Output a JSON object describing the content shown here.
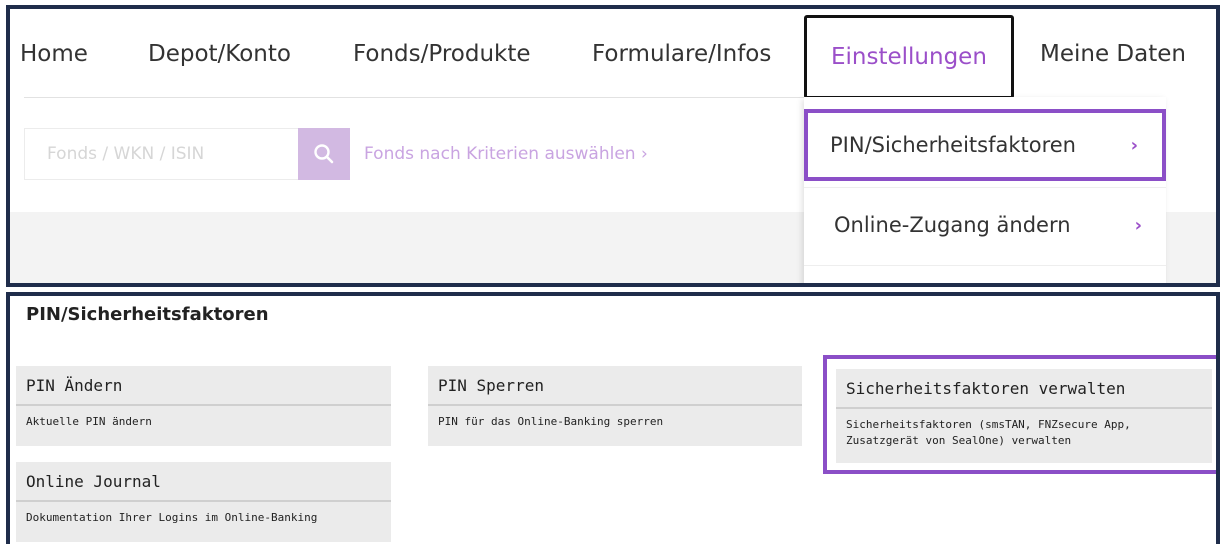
{
  "nav": {
    "items": [
      {
        "label": "Home"
      },
      {
        "label": "Depot/Konto"
      },
      {
        "label": "Fonds/Produkte"
      },
      {
        "label": "Formulare/Infos"
      },
      {
        "label": "Einstellungen",
        "active": true
      },
      {
        "label": "Meine Daten"
      }
    ]
  },
  "search": {
    "placeholder": "Fonds / WKN / ISIN",
    "button_icon": "search-icon",
    "criteria_link": "Fonds nach Kriterien auswählen ›"
  },
  "dropdown": {
    "items": [
      {
        "label": "PIN/Sicherheitsfaktoren",
        "highlighted": true
      },
      {
        "label": "Online-Zugang ändern"
      }
    ],
    "chevron": "›"
  },
  "settings": {
    "title": "PIN/Sicherheitsfaktoren",
    "cards": [
      {
        "title": "PIN Ändern",
        "description": "Aktuelle PIN ändern"
      },
      {
        "title": "PIN Sperren",
        "description": "PIN für das Online-Banking sperren"
      },
      {
        "title": "Sicherheitsfaktoren verwalten",
        "description": "Sicherheitsfaktoren (smsTAN, FNZsecure App, Zusatzgerät von SealOne) verwalten",
        "highlighted": true
      },
      {
        "title": "Online Journal",
        "description": "Dokumentation Ihrer Logins im Online-Banking"
      }
    ]
  },
  "colors": {
    "accent": "#9b4fc9",
    "highlight_border": "#8b4fc7",
    "frame": "#1f2d4b",
    "card_bg": "#ebebeb"
  }
}
